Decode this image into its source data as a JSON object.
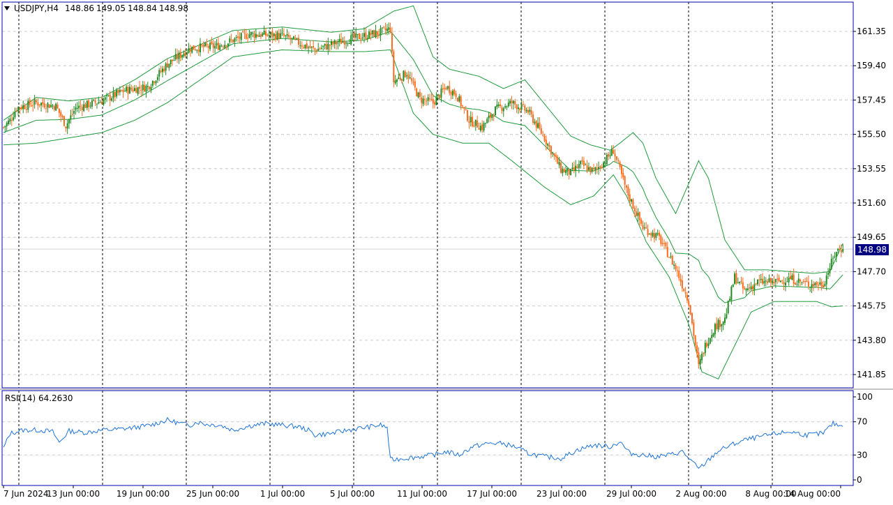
{
  "header": {
    "symbol_label": "USDJPY,H4",
    "quote": {
      "open": "148.86",
      "high": "149.05",
      "low": "148.84",
      "close": "148.98"
    }
  },
  "current_price_label": "148.98",
  "rsi_label": "RSI(14) 64.2630",
  "colors": {
    "bull": "#228b22",
    "bear": "#ff6a1a",
    "bands": "#1e9a3c",
    "rsi": "#1e73d6",
    "frame": "#0000aa",
    "grid": "#c8c8c8",
    "price_tag_bg": "#000080"
  },
  "chart_data": [
    {
      "type": "candlestick",
      "title": "USDJPY,H4",
      "ylim": [
        140.9,
        162.9
      ],
      "y_ticks": [
        "161.35",
        "159.40",
        "157.45",
        "155.50",
        "153.55",
        "151.60",
        "149.65",
        "147.70",
        "145.75",
        "143.80",
        "141.85"
      ],
      "x_ticks": [
        "7 Jun 2024",
        "13 Jun 00:00",
        "19 Jun 00:00",
        "25 Jun 00:00",
        "1 Jul 00:00",
        "5 Jul 00:00",
        "11 Jul 00:00",
        "17 Jul 00:00",
        "23 Jul 00:00",
        "29 Jul 00:00",
        "2 Aug 00:00",
        "8 Aug 00:00",
        "14 Aug 00:00"
      ],
      "last_price": 148.98,
      "price_anchors": [
        [
          0,
          155.9
        ],
        [
          4,
          156.3
        ],
        [
          8,
          157.0
        ],
        [
          20,
          157.3
        ],
        [
          32,
          157.1
        ],
        [
          38,
          156.0
        ],
        [
          44,
          157.0
        ],
        [
          60,
          157.4
        ],
        [
          74,
          158.0
        ],
        [
          88,
          158.2
        ],
        [
          100,
          159.5
        ],
        [
          114,
          160.4
        ],
        [
          130,
          160.5
        ],
        [
          150,
          161.2
        ],
        [
          170,
          161.1
        ],
        [
          190,
          160.3
        ],
        [
          210,
          160.9
        ],
        [
          230,
          161.3
        ],
        [
          236,
          161.5
        ],
        [
          238,
          158.5
        ],
        [
          246,
          159.0
        ],
        [
          254,
          157.5
        ],
        [
          262,
          157.3
        ],
        [
          270,
          158.2
        ],
        [
          276,
          157.8
        ],
        [
          284,
          156.3
        ],
        [
          292,
          155.9
        ],
        [
          300,
          156.9
        ],
        [
          310,
          157.3
        ],
        [
          320,
          156.8
        ],
        [
          330,
          155.3
        ],
        [
          340,
          153.5
        ],
        [
          346,
          153.3
        ],
        [
          352,
          153.8
        ],
        [
          360,
          153.4
        ],
        [
          366,
          153.9
        ],
        [
          372,
          154.6
        ],
        [
          380,
          152.3
        ],
        [
          390,
          150.2
        ],
        [
          400,
          149.6
        ],
        [
          410,
          147.9
        ],
        [
          418,
          146.0
        ],
        [
          424,
          142.3
        ],
        [
          428,
          143.5
        ],
        [
          434,
          144.6
        ],
        [
          440,
          145.0
        ],
        [
          446,
          147.4
        ],
        [
          452,
          146.6
        ],
        [
          460,
          147.1
        ],
        [
          470,
          147.1
        ],
        [
          480,
          147.3
        ],
        [
          490,
          147.0
        ],
        [
          500,
          147.0
        ],
        [
          508,
          148.9
        ],
        [
          512,
          148.98
        ]
      ],
      "upper_band_anchors": [
        [
          0,
          156.3
        ],
        [
          20,
          157.6
        ],
        [
          40,
          157.4
        ],
        [
          60,
          157.6
        ],
        [
          80,
          158.6
        ],
        [
          100,
          159.8
        ],
        [
          120,
          160.6
        ],
        [
          140,
          161.4
        ],
        [
          170,
          161.6
        ],
        [
          200,
          161.3
        ],
        [
          220,
          161.5
        ],
        [
          238,
          162.5
        ],
        [
          250,
          162.8
        ],
        [
          262,
          159.9
        ],
        [
          272,
          159.2
        ],
        [
          290,
          158.8
        ],
        [
          305,
          158.1
        ],
        [
          318,
          158.6
        ],
        [
          332,
          157.0
        ],
        [
          346,
          155.4
        ],
        [
          358,
          154.9
        ],
        [
          370,
          154.6
        ],
        [
          376,
          155.0
        ],
        [
          384,
          155.6
        ],
        [
          390,
          155.0
        ],
        [
          398,
          153.0
        ],
        [
          410,
          151.0
        ],
        [
          424,
          154.0
        ],
        [
          430,
          153.0
        ],
        [
          440,
          149.5
        ],
        [
          452,
          147.8
        ],
        [
          466,
          147.8
        ],
        [
          480,
          147.7
        ],
        [
          494,
          147.6
        ],
        [
          504,
          147.7
        ],
        [
          512,
          149.3
        ]
      ],
      "lower_band_anchors": [
        [
          0,
          154.9
        ],
        [
          20,
          155.0
        ],
        [
          40,
          155.3
        ],
        [
          60,
          155.6
        ],
        [
          80,
          156.3
        ],
        [
          100,
          157.3
        ],
        [
          120,
          158.6
        ],
        [
          140,
          159.9
        ],
        [
          170,
          160.3
        ],
        [
          200,
          160.2
        ],
        [
          220,
          160.2
        ],
        [
          236,
          160.3
        ],
        [
          250,
          156.7
        ],
        [
          262,
          155.5
        ],
        [
          280,
          155.0
        ],
        [
          296,
          155.0
        ],
        [
          310,
          154.0
        ],
        [
          330,
          152.5
        ],
        [
          346,
          151.5
        ],
        [
          360,
          152.0
        ],
        [
          372,
          153.2
        ],
        [
          380,
          152.0
        ],
        [
          392,
          149.4
        ],
        [
          406,
          147.4
        ],
        [
          418,
          144.7
        ],
        [
          426,
          142.0
        ],
        [
          436,
          141.6
        ],
        [
          446,
          143.5
        ],
        [
          456,
          145.4
        ],
        [
          470,
          146.0
        ],
        [
          484,
          146.0
        ],
        [
          496,
          146.0
        ],
        [
          505,
          145.7
        ],
        [
          512,
          145.75
        ]
      ]
    },
    {
      "type": "line",
      "title": "RSI(14) 64.2630",
      "ylim": [
        0,
        100
      ],
      "y_ticks": [
        100,
        70,
        30,
        0
      ],
      "last_value": 64.263,
      "rsi_anchors": [
        [
          0,
          38
        ],
        [
          4,
          56
        ],
        [
          12,
          60
        ],
        [
          22,
          60
        ],
        [
          30,
          58
        ],
        [
          34,
          45
        ],
        [
          40,
          59
        ],
        [
          50,
          57
        ],
        [
          60,
          60
        ],
        [
          70,
          61
        ],
        [
          80,
          63
        ],
        [
          90,
          66
        ],
        [
          96,
          70
        ],
        [
          100,
          72
        ],
        [
          108,
          68
        ],
        [
          114,
          66
        ],
        [
          118,
          70
        ],
        [
          124,
          67
        ],
        [
          132,
          66
        ],
        [
          140,
          60
        ],
        [
          150,
          65
        ],
        [
          160,
          68
        ],
        [
          170,
          66
        ],
        [
          180,
          64
        ],
        [
          186,
          60
        ],
        [
          190,
          54
        ],
        [
          200,
          56
        ],
        [
          210,
          60
        ],
        [
          220,
          63
        ],
        [
          230,
          66
        ],
        [
          234,
          63
        ],
        [
          236,
          24
        ],
        [
          244,
          26
        ],
        [
          254,
          28
        ],
        [
          262,
          30
        ],
        [
          270,
          34
        ],
        [
          278,
          30
        ],
        [
          286,
          40
        ],
        [
          296,
          44
        ],
        [
          304,
          44
        ],
        [
          312,
          40
        ],
        [
          320,
          32
        ],
        [
          330,
          28
        ],
        [
          340,
          26
        ],
        [
          350,
          36
        ],
        [
          360,
          42
        ],
        [
          370,
          40
        ],
        [
          376,
          46
        ],
        [
          382,
          32
        ],
        [
          390,
          30
        ],
        [
          398,
          28
        ],
        [
          406,
          30
        ],
        [
          414,
          34
        ],
        [
          420,
          22
        ],
        [
          424,
          13
        ],
        [
          428,
          20
        ],
        [
          436,
          35
        ],
        [
          444,
          42
        ],
        [
          452,
          48
        ],
        [
          462,
          52
        ],
        [
          472,
          56
        ],
        [
          480,
          58
        ],
        [
          490,
          54
        ],
        [
          500,
          56
        ],
        [
          506,
          68
        ],
        [
          512,
          64.26
        ]
      ]
    }
  ]
}
